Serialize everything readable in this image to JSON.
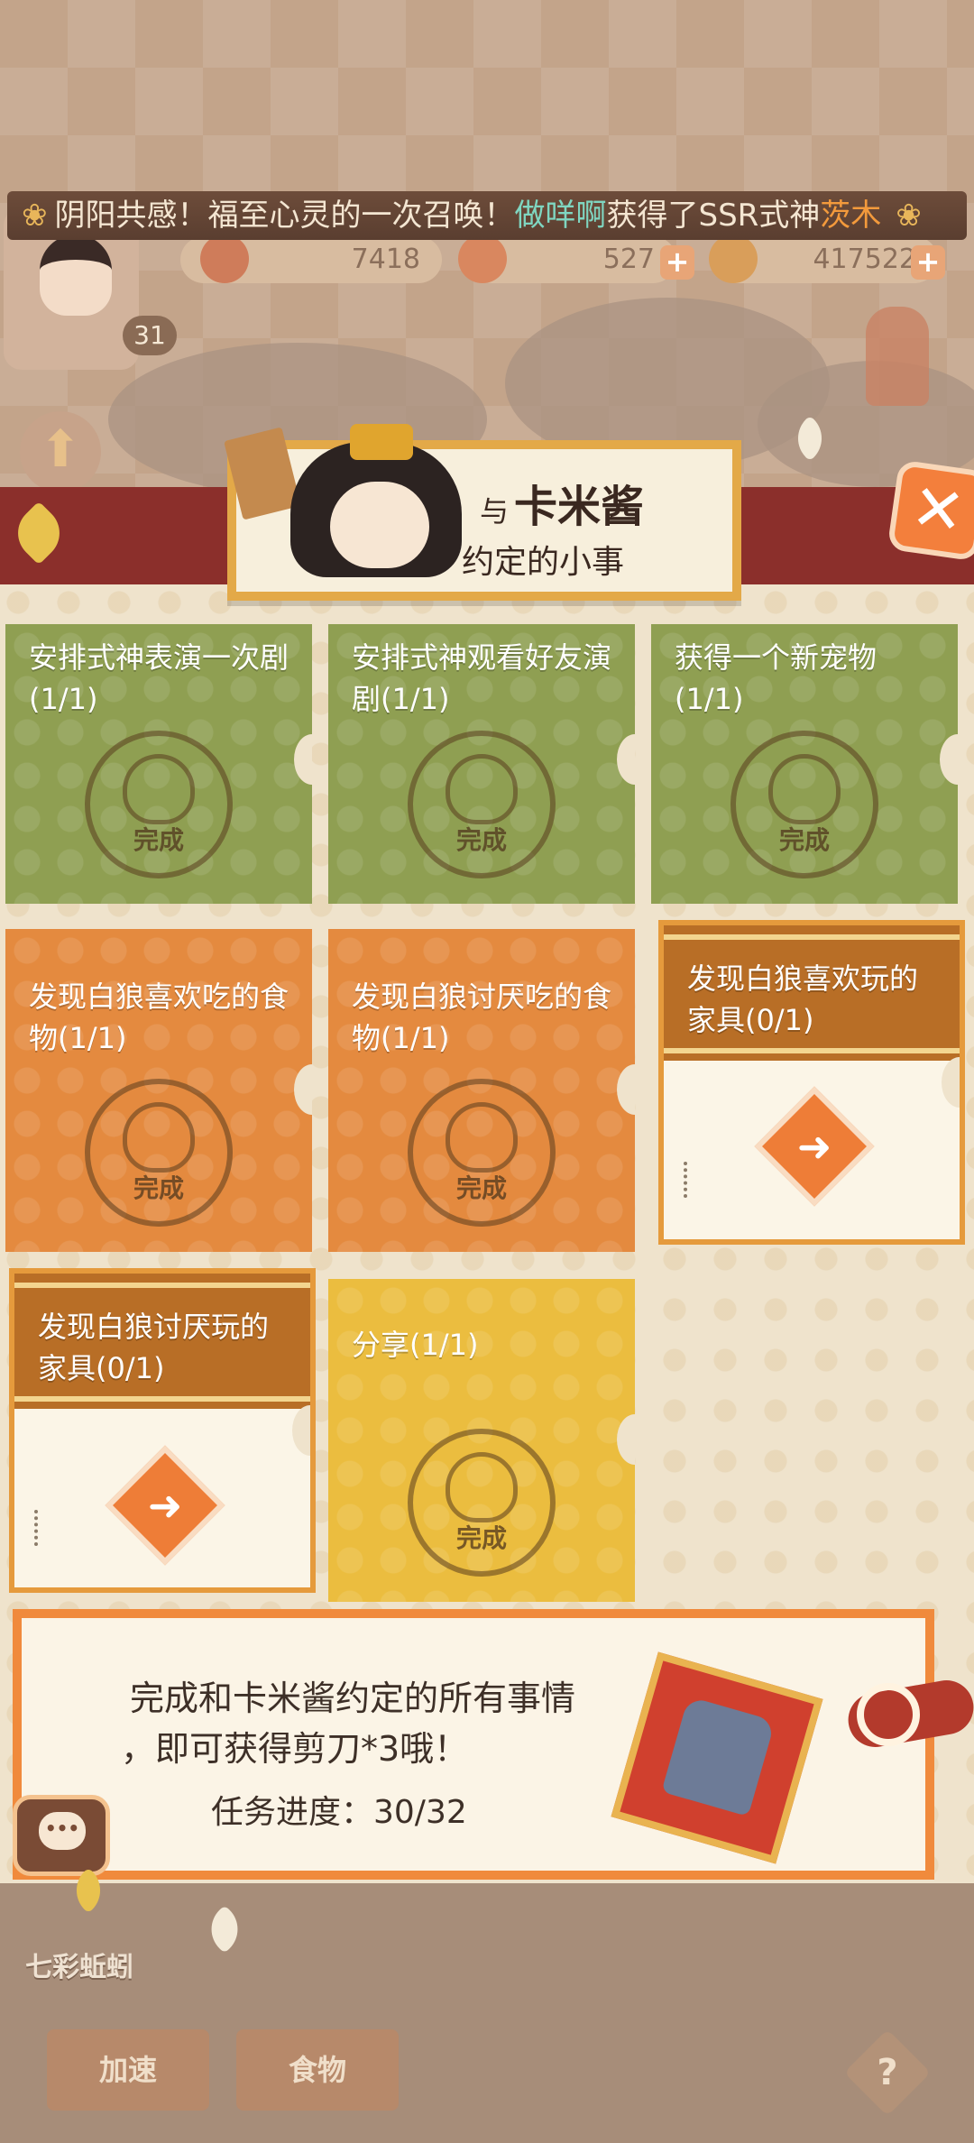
{
  "announcement": {
    "prefix": "阴阳共感！福至心灵的一次召唤！",
    "player": "做咩啊",
    "middle": "获得了SSR式神",
    "shikigami": "茨木"
  },
  "resources": {
    "resource_1": "7418",
    "resource_2": "527",
    "coins": "417522",
    "plus": "+"
  },
  "player": {
    "level": "31"
  },
  "panel": {
    "title_prefix": "与",
    "title_name": "卡米酱",
    "subtitle": "约定的小事",
    "close_label": "✕"
  },
  "tasks": [
    {
      "title": "安排式神表演一次剧(1/1)",
      "status": "完成",
      "color": "green"
    },
    {
      "title": "安排式神观看好友演剧(1/1)",
      "status": "完成",
      "color": "green"
    },
    {
      "title": "获得一个新宠物(1/1)",
      "status": "完成",
      "color": "green"
    },
    {
      "title": "发现白狼喜欢吃的食物(1/1)",
      "status": "完成",
      "color": "orange"
    },
    {
      "title": "发现白狼讨厌吃的食物(1/1)",
      "status": "完成",
      "color": "orange"
    },
    {
      "title": "发现白狼喜欢玩的家具(0/1)",
      "status": "",
      "color": "pending"
    },
    {
      "title": "发现白狼讨厌玩的家具(0/1)",
      "status": "",
      "color": "pending"
    },
    {
      "title": "分享(1/1)",
      "status": "完成",
      "color": "yellow"
    }
  ],
  "go_arrow": "➜",
  "reward": {
    "line1": "完成和卡米酱约定的所有事情",
    "line2": "，即可获得剪刀*3哦！",
    "progress_label": "任务进度：30/32"
  },
  "bottom": {
    "rainbow_label": "七彩蚯蚓",
    "speedup_label": "加速",
    "food_label": "食物",
    "help_label": "?"
  }
}
